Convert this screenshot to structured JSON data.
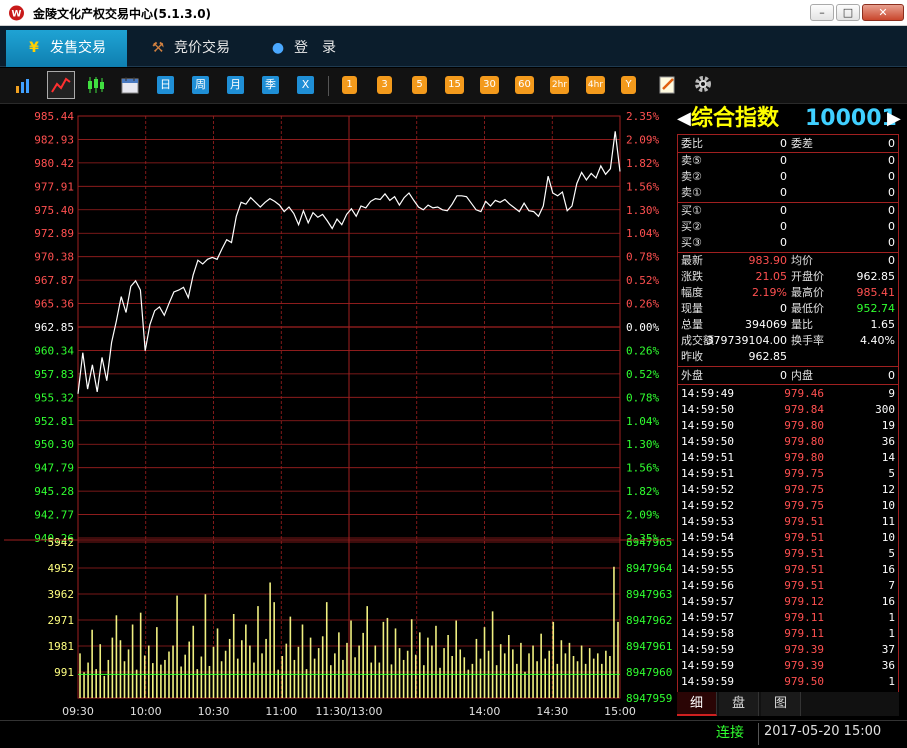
{
  "window": {
    "title": "金陵文化产权交易中心(5.1.3.0)",
    "controls": {
      "minimize": "–",
      "maximize": "□",
      "close": "✕"
    }
  },
  "nav": {
    "tabs": [
      {
        "label": "发售交易",
        "icon": "yen-icon",
        "active": true
      },
      {
        "label": "竞价交易",
        "icon": "gavel-icon",
        "active": false
      },
      {
        "label": "登　录",
        "icon": "user-icon",
        "active": false
      }
    ]
  },
  "toolbar": {
    "chart_type_icons": [
      "bar-chart-icon",
      "line-chart-icon",
      "candlestick-icon",
      "calendar-icon"
    ],
    "period_buttons": [
      "日",
      "周",
      "月",
      "季",
      "X"
    ],
    "minute_buttons": [
      "1",
      "3",
      "5",
      "15",
      "30",
      "60",
      "2hr",
      "4hr",
      "Y"
    ],
    "tool_icons": [
      "edit-icon",
      "gear-icon"
    ]
  },
  "colors": {
    "up": "#ff5050",
    "down": "#30ff30",
    "neutral": "#ffffff",
    "grid": "#a02020",
    "price_line": "#ffffff",
    "volume_bar": "#f0f080",
    "avg_line": "#30ff30",
    "title_yellow": "#ffff00",
    "code_cyan": "#40d0ff"
  },
  "chart_data": {
    "type": "line",
    "title": "",
    "price_axis": {
      "left_ticks": [
        "985.44",
        "982.93",
        "980.42",
        "977.91",
        "975.40",
        "972.89",
        "970.38",
        "967.87",
        "965.36",
        "962.85",
        "960.34",
        "957.83",
        "955.32",
        "952.81",
        "950.30",
        "947.79",
        "945.28",
        "942.77",
        "940.26"
      ],
      "right_ticks": [
        "2.35%",
        "2.09%",
        "1.82%",
        "1.56%",
        "1.30%",
        "1.04%",
        "0.78%",
        "0.52%",
        "0.26%",
        "0.00%",
        "0.26%",
        "0.52%",
        "0.78%",
        "1.04%",
        "1.30%",
        "1.56%",
        "1.82%",
        "2.09%",
        "2.35%"
      ],
      "ylim": [
        940.26,
        985.44
      ],
      "prev_close": 962.85
    },
    "volume_axis": {
      "left_ticks": [
        "5942",
        "4952",
        "3962",
        "2971",
        "1981",
        "991"
      ],
      "right_ticks": [
        "8947965",
        "8947964",
        "8947963",
        "8947962",
        "8947961",
        "8947960",
        "8947959"
      ],
      "ylim": [
        0,
        5942
      ]
    },
    "x_labels": [
      "09:30",
      "10:00",
      "10:30",
      "11:00",
      "11:30/13:00",
      "14:00",
      "14:30",
      "15:00"
    ],
    "series": [
      {
        "kind": "price",
        "values": [
          955.7,
          960.1,
          956.2,
          958.8,
          955.9,
          959.6,
          957.1,
          961.2,
          963.5,
          966.1,
          964.4,
          967.2,
          967.8,
          966.8,
          960.3,
          963.1,
          964.6,
          965.0,
          964.1,
          965.4,
          966.6,
          966.8,
          967.1,
          966.0,
          968.4,
          970.0,
          969.6,
          970.1,
          970.3,
          970.1,
          971.2,
          972.2,
          971.9,
          974.7,
          976.2,
          976.0,
          976.7,
          976.2,
          975.7,
          976.2,
          976.6,
          976.3,
          975.9,
          975.2,
          975.7,
          975.0,
          973.8,
          975.3,
          974.0,
          975.1,
          974.6,
          974.9,
          974.2,
          973.4,
          974.4,
          973.8,
          974.9,
          975.5,
          974.7,
          975.8,
          975.6,
          976.3,
          976.6,
          976.5,
          977.1,
          976.4,
          976.8,
          975.9,
          976.7,
          977.2,
          976.4,
          975.7,
          975.4,
          975.9,
          975.6,
          975.7,
          975.4,
          975.3,
          976.0,
          976.9,
          976.9,
          976.8,
          976.1,
          975.4,
          975.2,
          976.3,
          975.8,
          976.4,
          976.2,
          976.5,
          976.0,
          975.6,
          975.2,
          976.1,
          975.3,
          975.2,
          974.7,
          975.8,
          979.0,
          977.2,
          976.9,
          977.3,
          975.3,
          975.8,
          978.2,
          979.4,
          978.6,
          979.3,
          978.8,
          980.1,
          979.2,
          979.8,
          983.8,
          979.5
        ]
      },
      {
        "kind": "volume",
        "values": [
          1700,
          980,
          1350,
          2600,
          1100,
          2050,
          840,
          1450,
          2300,
          3150,
          2200,
          1400,
          1850,
          2800,
          1080,
          3250,
          1620,
          2000,
          1330,
          2700,
          1270,
          1450,
          1770,
          2000,
          3900,
          1200,
          1650,
          2150,
          2750,
          1100,
          1580,
          3950,
          1220,
          1950,
          2650,
          1400,
          1800,
          2250,
          3200,
          1500,
          2200,
          2800,
          2000,
          1350,
          3500,
          1700,
          2250,
          4400,
          3650,
          1080,
          1600,
          2070,
          3100,
          1450,
          1950,
          2800,
          1100,
          2300,
          1500,
          1900,
          2350,
          3650,
          1250,
          1700,
          2500,
          1450,
          2100,
          2950,
          1550,
          2000,
          2480,
          3500,
          1350,
          2000,
          1350,
          2900,
          3050,
          1280,
          2650,
          1900,
          1450,
          1800,
          3000,
          1650,
          2500,
          1250,
          2300,
          2000,
          2750,
          1150,
          1900,
          2400,
          1600,
          2950,
          1850,
          1550,
          1080,
          1300,
          2250,
          1500,
          2700,
          1800,
          3300,
          1250,
          2050,
          1700,
          2400,
          1850,
          1300,
          2100,
          1000,
          1700,
          2000,
          1400,
          2450,
          1500,
          1800,
          2900,
          1300,
          2200,
          1700,
          2100,
          1600,
          1400,
          2000,
          1300,
          1900,
          1500,
          1700,
          1300,
          1800,
          1600,
          5000,
          2900
        ]
      }
    ],
    "avg_line_value": 962.85
  },
  "panel": {
    "title": "综合指数",
    "code": "100001",
    "weibi": {
      "label": "委比",
      "value": "0",
      "label2": "委差",
      "value2": "0"
    },
    "asks": [
      {
        "label": "卖⑤",
        "price": "0",
        "qty": "0"
      },
      {
        "label": "卖②",
        "price": "0",
        "qty": "0"
      },
      {
        "label": "卖①",
        "price": "0",
        "qty": "0"
      }
    ],
    "bids": [
      {
        "label": "买①",
        "price": "0",
        "qty": "0"
      },
      {
        "label": "买②",
        "price": "0",
        "qty": "0"
      },
      {
        "label": "买③",
        "price": "0",
        "qty": "0"
      }
    ],
    "stats": [
      {
        "l1": "最新",
        "v1": "983.90",
        "c1": "red",
        "l2": "均价",
        "v2": "0",
        "c2": "w"
      },
      {
        "l1": "涨跌",
        "v1": "21.05",
        "c1": "red",
        "l2": "开盘价",
        "v2": "962.85",
        "c2": "w"
      },
      {
        "l1": "幅度",
        "v1": "2.19%",
        "c1": "red",
        "l2": "最高价",
        "v2": "985.41",
        "c2": "red"
      },
      {
        "l1": "现量",
        "v1": "0",
        "c1": "w",
        "l2": "最低价",
        "v2": "952.74",
        "c2": "green"
      },
      {
        "l1": "总量",
        "v1": "394069",
        "c1": "w",
        "l2": "量比",
        "v2": "1.65",
        "c2": "w"
      },
      {
        "l1": "成交额",
        "v1": "379739104.00",
        "c1": "w",
        "l2": "换手率",
        "v2": "4.40%",
        "c2": "w"
      },
      {
        "l1": "昨收",
        "v1": "962.85",
        "c1": "w",
        "l2": "",
        "v2": "",
        "c2": "w"
      }
    ],
    "outer": {
      "label": "外盘",
      "value": "0",
      "label2": "内盘",
      "value2": "0"
    },
    "ticks": [
      {
        "time": "14:59:49",
        "price": "979.46",
        "qty": "9"
      },
      {
        "time": "14:59:50",
        "price": "979.84",
        "qty": "300"
      },
      {
        "time": "14:59:50",
        "price": "979.80",
        "qty": "19"
      },
      {
        "time": "14:59:50",
        "price": "979.80",
        "qty": "36"
      },
      {
        "time": "14:59:51",
        "price": "979.80",
        "qty": "14"
      },
      {
        "time": "14:59:51",
        "price": "979.75",
        "qty": "5"
      },
      {
        "time": "14:59:52",
        "price": "979.75",
        "qty": "12"
      },
      {
        "time": "14:59:52",
        "price": "979.75",
        "qty": "10"
      },
      {
        "time": "14:59:53",
        "price": "979.51",
        "qty": "11"
      },
      {
        "time": "14:59:54",
        "price": "979.51",
        "qty": "10"
      },
      {
        "time": "14:59:55",
        "price": "979.51",
        "qty": "5"
      },
      {
        "time": "14:59:55",
        "price": "979.51",
        "qty": "16"
      },
      {
        "time": "14:59:56",
        "price": "979.51",
        "qty": "7"
      },
      {
        "time": "14:59:57",
        "price": "979.12",
        "qty": "16"
      },
      {
        "time": "14:59:57",
        "price": "979.11",
        "qty": "1"
      },
      {
        "time": "14:59:58",
        "price": "979.11",
        "qty": "1"
      },
      {
        "time": "14:59:59",
        "price": "979.39",
        "qty": "37"
      },
      {
        "time": "14:59:59",
        "price": "979.39",
        "qty": "36"
      },
      {
        "time": "14:59:59",
        "price": "979.50",
        "qty": "1"
      }
    ],
    "tabs": [
      "细",
      "盘",
      "图"
    ]
  },
  "status": {
    "connection": "连接",
    "datetime": "2017-05-20 15:00"
  }
}
